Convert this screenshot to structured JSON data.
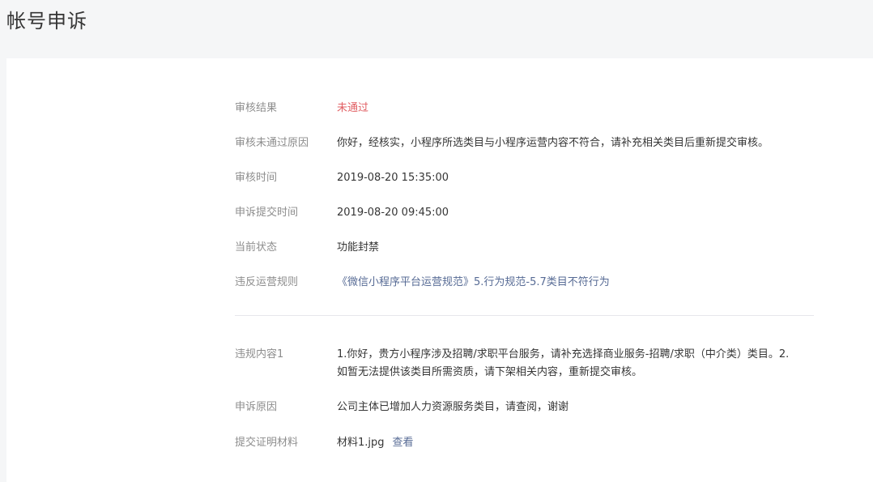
{
  "page": {
    "title": "帐号申诉"
  },
  "details": {
    "review_result": {
      "label": "审核结果",
      "value": "未通过"
    },
    "reject_reason": {
      "label": "审核未通过原因",
      "value": "你好，经核实，小程序所选类目与小程序运营内容不符合，请补充相关类目后重新提交审核。"
    },
    "review_time": {
      "label": "审核时间",
      "value": "2019-08-20 15:35:00"
    },
    "appeal_submit_time": {
      "label": "申诉提交时间",
      "value": "2019-08-20 09:45:00"
    },
    "current_status": {
      "label": "当前状态",
      "value": "功能封禁"
    },
    "violated_rule": {
      "label": "违反运营规则",
      "value": "《微信小程序平台运营规范》5.行为规范-5.7类目不符行为"
    }
  },
  "appeal": {
    "violation_content": {
      "label": "违规内容1",
      "value": "1.你好，贵方小程序涉及招聘/求职平台服务，请补充选择商业服务-招聘/求职（中介类）类目。2.如暂无法提供该类目所需资质，请下架相关内容，重新提交审核。"
    },
    "appeal_reason": {
      "label": "申诉原因",
      "value": "公司主体已增加人力资源服务类目，请查阅，谢谢"
    },
    "evidence": {
      "label": "提交证明材料",
      "file_name": "材料1.jpg",
      "view_label": "查看"
    }
  },
  "colors": {
    "background": "#f5f6f7",
    "panel": "#ffffff",
    "label": "#8d8d8d",
    "text": "#353535",
    "rejected": "#e15f63",
    "link": "#576b95"
  }
}
